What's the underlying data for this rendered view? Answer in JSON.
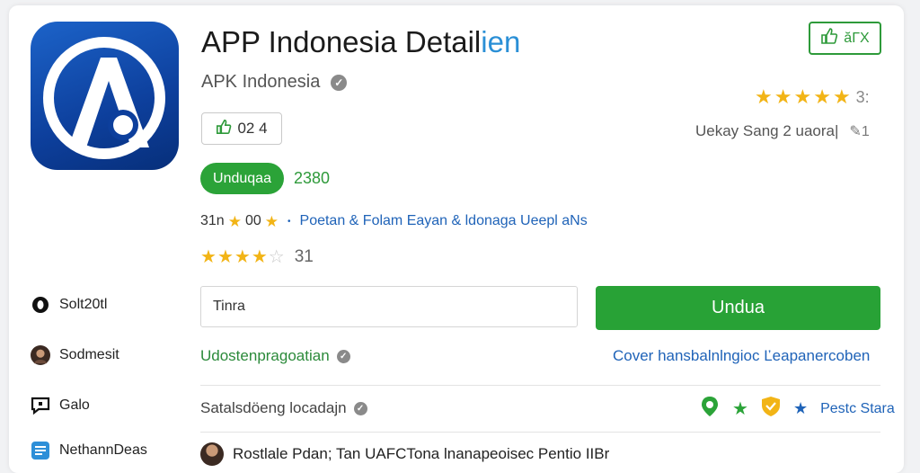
{
  "app": {
    "title": "APP Indonesia Detail",
    "title_suffix": "ien",
    "developer": "APK Indonesia",
    "icon_name": "app-logo-icon",
    "brand_color": "#1c63c9"
  },
  "like_button": {
    "label": "ăΓX"
  },
  "rating_top": {
    "stars": 5,
    "count": "3:"
  },
  "thumb_box": {
    "value": "02 4"
  },
  "update_info": {
    "text": "Uekay Sang 2 uaora|",
    "edit_value": "1"
  },
  "download_pill": {
    "label": "Unduqaa",
    "count": "2380"
  },
  "category_line": {
    "prefix": "31n",
    "suffix": "00",
    "links": "Poetan & Folam Eayan  & ldonaga Ueepl aNs"
  },
  "rating_row": {
    "stars": 4,
    "max": 5,
    "count": "31"
  },
  "search": {
    "value": "Tinra"
  },
  "primary_button": {
    "label": "Undua",
    "color": "#28a236"
  },
  "sidebar": {
    "items": [
      {
        "label": "Solt20tl",
        "icon": "circle-icon"
      },
      {
        "label": "Sodmesit",
        "icon": "avatar"
      },
      {
        "label": "Galo",
        "icon": "chat-icon"
      },
      {
        "label": "NethannDeas",
        "icon": "list-icon"
      }
    ]
  },
  "links": {
    "green": "Udostenpragoatian",
    "blue": "Cover hansbalnlngioc Ľeapanercoben"
  },
  "detail_line": {
    "text": "Satalsdöeng locadajn"
  },
  "badges": {
    "label": "Pestc Stara"
  },
  "bottom": {
    "text": "Rostlale Pdan; Tan UAFCTona lnanapeoisec Pentio IIBr"
  }
}
